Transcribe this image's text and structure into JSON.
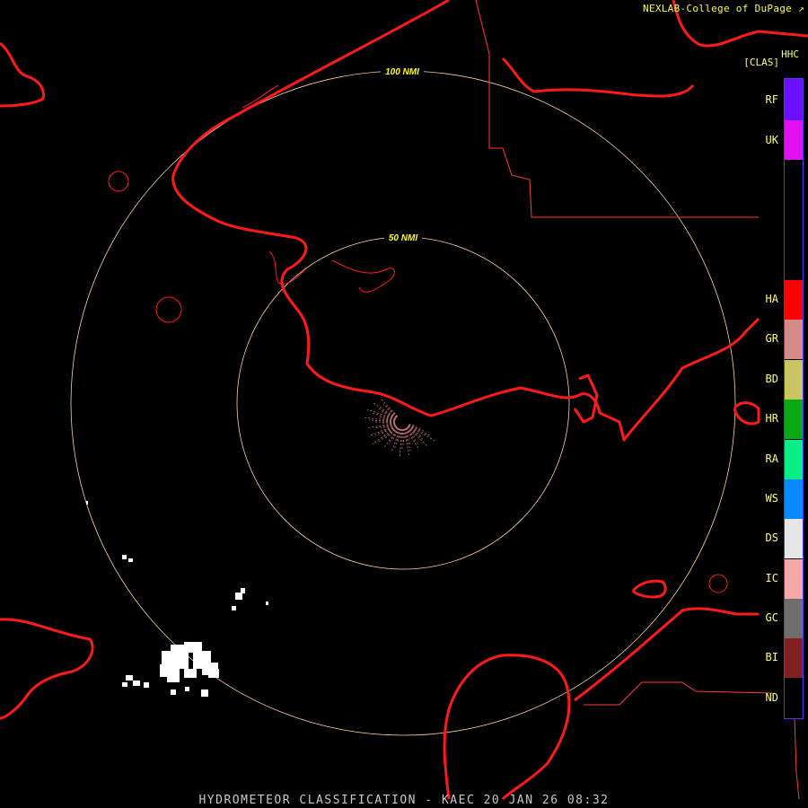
{
  "credit": "NEXLAB-College of DuPage",
  "credit_icon": "external-link-icon",
  "product_code": "HHC",
  "product_class": "[CLAS]",
  "range_rings": [
    {
      "label": "50 NMI"
    },
    {
      "label": "100 NMI"
    }
  ],
  "legend": [
    {
      "code": "RF",
      "color": "#6a10ff"
    },
    {
      "code": "UK",
      "color": "#e010f0"
    },
    {
      "code": "HA",
      "color": "#ff0000"
    },
    {
      "code": "GR",
      "color": "#d38a88"
    },
    {
      "code": "BD",
      "color": "#cbc463"
    },
    {
      "code": "HR",
      "color": "#0aa814"
    },
    {
      "code": "RA",
      "color": "#0aee88"
    },
    {
      "code": "WS",
      "color": "#0a88ff"
    },
    {
      "code": "DS",
      "color": "#e6e6e6"
    },
    {
      "code": "IC",
      "color": "#f4a8a8"
    },
    {
      "code": "GC",
      "color": "#6e6e6e"
    },
    {
      "code": "BI",
      "color": "#802020"
    },
    {
      "code": "ND",
      "color": "#000000"
    }
  ],
  "colors": {
    "coastline": "#ff1a1a",
    "boundary": "#ff3a3a",
    "range_ring": "#ffd0a0",
    "ring_label": "#ffff00",
    "echo": "#ffffff",
    "clutter": "#c07070"
  },
  "footer": "HYDROMETEOR CLASSIFICATION - KAEC 20 JAN 26 08:32"
}
